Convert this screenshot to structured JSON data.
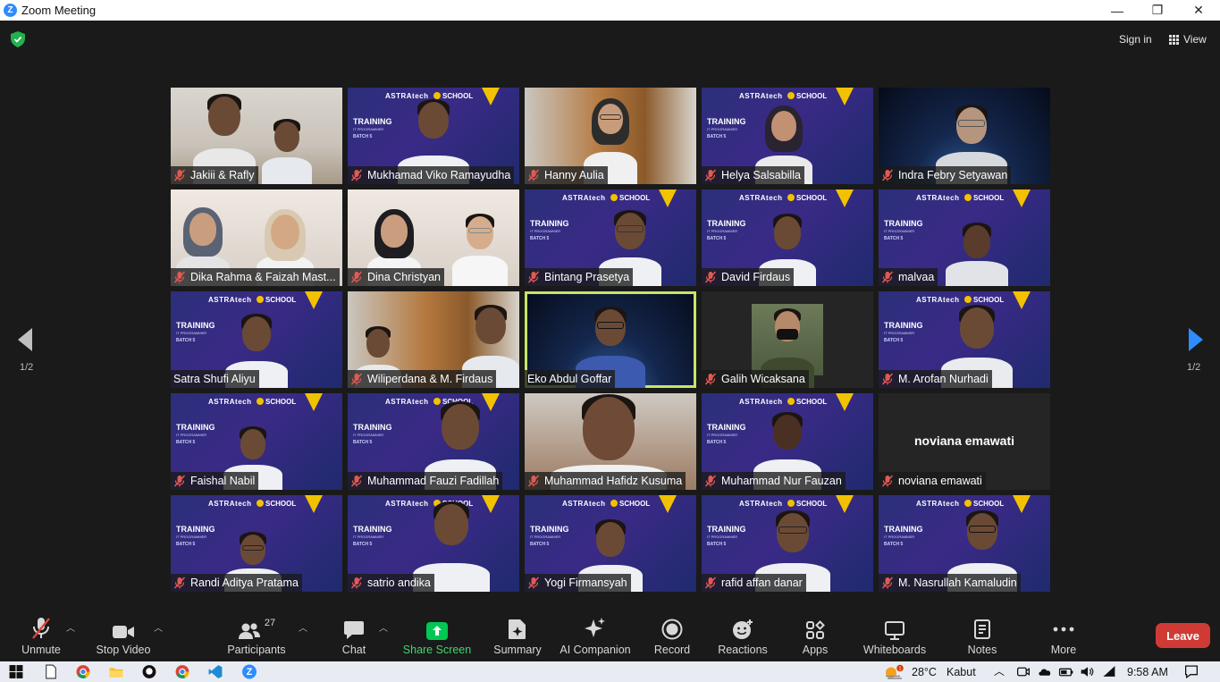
{
  "window": {
    "title": "Zoom Meeting",
    "minimize": "—",
    "maximize": "❐",
    "close": "✕"
  },
  "header": {
    "signin": "Sign in",
    "view": "View"
  },
  "pager": {
    "left_label": "1/2",
    "right_label": "1/2"
  },
  "participants": [
    {
      "name": "Jakiii & Rafly",
      "muted": true,
      "bg": "room"
    },
    {
      "name": "Mukhamad Viko Ramayudha",
      "muted": true,
      "bg": "astra"
    },
    {
      "name": "Hanny Aulia",
      "muted": true,
      "bg": "wood"
    },
    {
      "name": "Helya Salsabilla",
      "muted": true,
      "bg": "astra"
    },
    {
      "name": "Indra Febry Setyawan",
      "muted": true,
      "bg": "space"
    },
    {
      "name": "Dika Rahma & Faizah Mast...",
      "muted": true,
      "bg": "plain"
    },
    {
      "name": "Dina Christyan",
      "muted": true,
      "bg": "plain"
    },
    {
      "name": "Bintang Prasetya",
      "muted": true,
      "bg": "astra"
    },
    {
      "name": "David Firdaus",
      "muted": true,
      "bg": "astra"
    },
    {
      "name": "malvaa",
      "muted": true,
      "bg": "astra"
    },
    {
      "name": "Satra Shufi Aliyu",
      "muted": false,
      "bg": "astra"
    },
    {
      "name": "Wiliperdana & M. Firdaus",
      "muted": true,
      "bg": "wood"
    },
    {
      "name": "Eko Abdul Goffar",
      "muted": false,
      "bg": "space",
      "active": true
    },
    {
      "name": "Galih Wicaksana",
      "muted": true,
      "bg": "dark"
    },
    {
      "name": "M. Arofan Nurhadi",
      "muted": true,
      "bg": "astra"
    },
    {
      "name": "Faishal Nabil",
      "muted": true,
      "bg": "astra"
    },
    {
      "name": "Muhammad Fauzi Fadillah",
      "muted": true,
      "bg": "astra"
    },
    {
      "name": "Muhammad Hafidz Kusuma",
      "muted": true,
      "bg": "face"
    },
    {
      "name": "Muhammad Nur Fauzan",
      "muted": true,
      "bg": "astra"
    },
    {
      "name": "noviana emawati",
      "muted": true,
      "bg": "dark",
      "no_video_name": "noviana emawati"
    },
    {
      "name": "Randi Aditya Pratama",
      "muted": true,
      "bg": "astra"
    },
    {
      "name": "satrio andika",
      "muted": true,
      "bg": "astra"
    },
    {
      "name": "Yogi Firmansyah",
      "muted": true,
      "bg": "astra"
    },
    {
      "name": "rafid affan danar",
      "muted": true,
      "bg": "astra"
    },
    {
      "name": "M. Nasrullah Kamaludin",
      "muted": true,
      "bg": "astra"
    }
  ],
  "banner": {
    "logo": "ASTRAtech",
    "school": "SCHOOL",
    "training": "TRAINING",
    "sub": "IT PROGRAMMER",
    "batch": "BATCH 5"
  },
  "toolbar": {
    "unmute": "Unmute",
    "stop_video": "Stop Video",
    "participants": "Participants",
    "participants_count": "27",
    "chat": "Chat",
    "share_screen": "Share Screen",
    "summary": "Summary",
    "ai_companion": "AI Companion",
    "record": "Record",
    "reactions": "Reactions",
    "apps": "Apps",
    "whiteboards": "Whiteboards",
    "notes": "Notes",
    "more": "More",
    "leave": "Leave"
  },
  "taskbar": {
    "temperature": "28°C",
    "weather": "Kabut",
    "time": "9:58 AM",
    "weather_badge": "1"
  },
  "colors": {
    "accent_green": "#00c853",
    "active_border": "#c6e56a",
    "leave_red": "#d03a35",
    "zoom_blue": "#2D8CFF",
    "nav_blue": "#2D8CFF"
  }
}
